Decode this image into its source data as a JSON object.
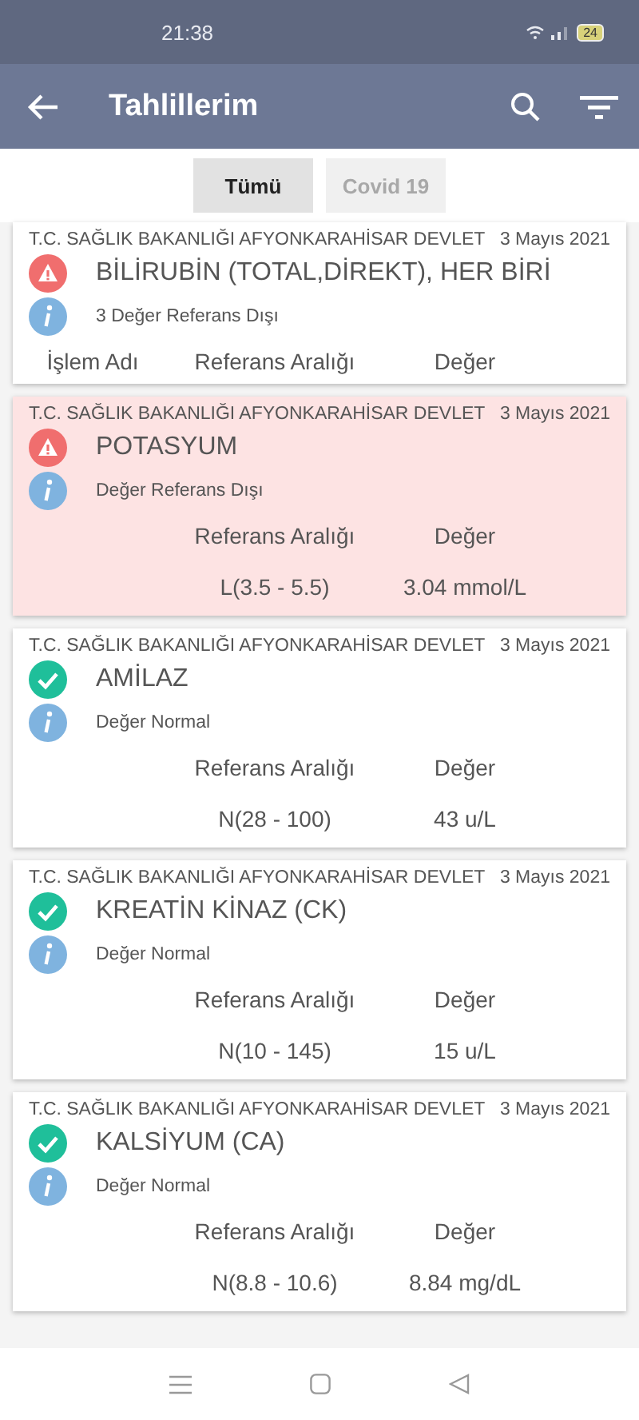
{
  "status_bar": {
    "time": "21:38",
    "battery": "24"
  },
  "app_bar": {
    "title": "Tahlillerim"
  },
  "tabs": [
    {
      "label": "Tümü",
      "selected": true
    },
    {
      "label": "Covid 19",
      "selected": false
    }
  ],
  "results": [
    {
      "institution": "T.C. SAĞLIK BAKANLIĞI AFYONKARAHİSAR DEVLET",
      "date": "3 Mayıs 2021",
      "kind": "warning",
      "highlighted": false,
      "test": "BİLİRUBİN (TOTAL,DİREKT), HER BİRİ",
      "note": "3 Değer Referans Dışı",
      "columns": {
        "name": "İşlem Adı",
        "range": "Referans Aralığı",
        "value": "Değer"
      }
    },
    {
      "institution": "T.C. SAĞLIK BAKANLIĞI AFYONKARAHİSAR DEVLET",
      "date": "3 Mayıs 2021",
      "kind": "warning",
      "highlighted": true,
      "test": "POTASYUM",
      "note": "Değer Referans Dışı",
      "columns": {
        "range": "Referans Aralığı",
        "value": "Değer"
      },
      "result": {
        "range": "L(3.5 - 5.5)",
        "value": "3.04 mmol/L"
      }
    },
    {
      "institution": "T.C. SAĞLIK BAKANLIĞI AFYONKARAHİSAR DEVLET",
      "date": "3 Mayıs 2021",
      "kind": "normal",
      "highlighted": false,
      "test": "AMİLAZ",
      "note": "Değer Normal",
      "columns": {
        "range": "Referans Aralığı",
        "value": "Değer"
      },
      "result": {
        "range": "N(28 - 100)",
        "value": "43 u/L"
      }
    },
    {
      "institution": "T.C. SAĞLIK BAKANLIĞI AFYONKARAHİSAR DEVLET",
      "date": "3 Mayıs 2021",
      "kind": "normal",
      "highlighted": false,
      "test": "KREATİN KİNAZ (CK)",
      "note": "Değer Normal",
      "columns": {
        "range": "Referans Aralığı",
        "value": "Değer"
      },
      "result": {
        "range": "N(10 - 145)",
        "value": "15 u/L"
      }
    },
    {
      "institution": "T.C. SAĞLIK BAKANLIĞI AFYONKARAHİSAR DEVLET",
      "date": "3 Mayıs 2021",
      "kind": "normal",
      "highlighted": false,
      "test": "KALSİYUM (CA)",
      "note": "Değer Normal",
      "columns": {
        "range": "Referans Aralığı",
        "value": "Değer"
      },
      "result": {
        "range": "N(8.8 - 10.6)",
        "value": "8.84 mg/dL"
      }
    }
  ]
}
